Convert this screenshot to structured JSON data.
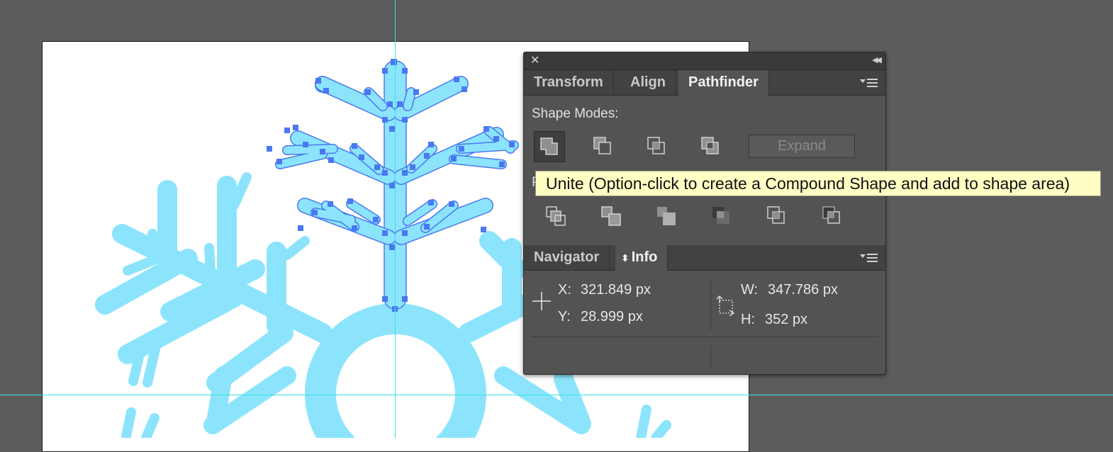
{
  "panel": {
    "top_tabs": [
      {
        "label": "Transform"
      },
      {
        "label": "Align"
      },
      {
        "label": "Pathfinder"
      }
    ],
    "active_top_tab": "Pathfinder",
    "shape_modes": {
      "label": "Shape Modes:",
      "buttons": [
        "unite-icon",
        "minus-front-icon",
        "intersect-icon",
        "exclude-icon"
      ],
      "expand_label": "Expand"
    },
    "pathfinders": {
      "label": "P",
      "buttons": [
        "divide-icon",
        "trim-icon",
        "merge-icon",
        "crop-icon",
        "outline-icon",
        "minus-back-icon"
      ]
    },
    "bottom_tabs": [
      {
        "label": "Navigator"
      },
      {
        "label": "Info",
        "prefix": "⬍"
      }
    ],
    "active_bottom_tab": "Info",
    "info": {
      "x_label": "X:",
      "x_value": "321.849 px",
      "y_label": "Y:",
      "y_value": "28.999 px",
      "w_label": "W:",
      "w_value": "347.786 px",
      "h_label": "H:",
      "h_value": "352 px"
    }
  },
  "tooltip": {
    "text": "Unite (Option-click to create a Compound Shape and add to shape area)"
  },
  "colors": {
    "canvas_bg": "#5c5c5c",
    "artboard": "#ffffff",
    "snowflake": "#8ce4fc",
    "selection": "#4a78f0",
    "guide": "#35e3e3",
    "panel_bg": "#535353"
  }
}
